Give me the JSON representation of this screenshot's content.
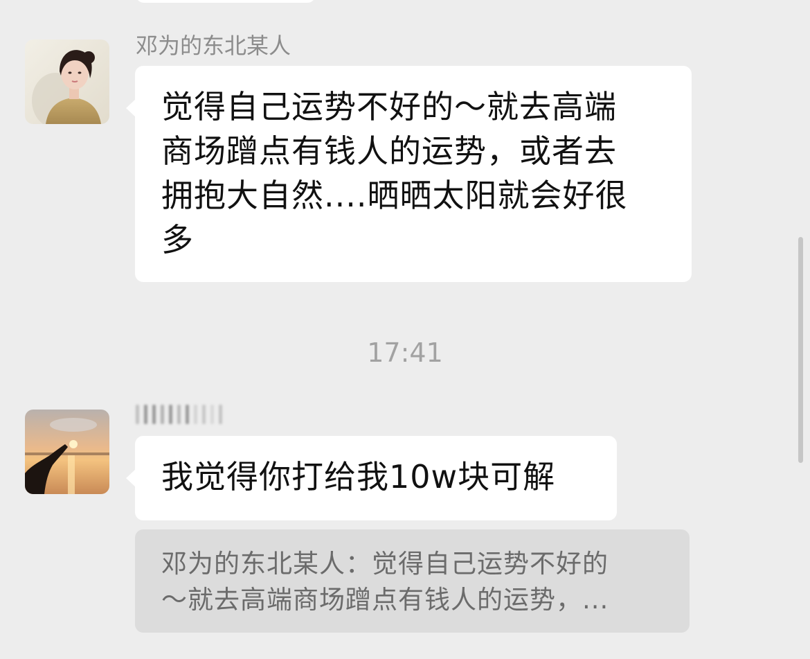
{
  "messages": [
    {
      "sender": "邓为的东北某人",
      "lines": [
        "觉得自己运势不好的～就去高端",
        "商场蹭点有钱人的运势，或者去",
        "拥抱大自然....晒晒太阳就会好很",
        "多"
      ]
    },
    {
      "sender": "",
      "lines": [
        "我觉得你打给我10w块可解"
      ]
    }
  ],
  "timestamp": "17:41",
  "quote": {
    "lines": [
      "邓为的东北某人：觉得自己运势不好的",
      "～就去高端商场蹭点有钱人的运势，..."
    ]
  },
  "icons": {
    "avatar_1": "woman-portrait-avatar",
    "avatar_2": "sunset-lake-avatar"
  }
}
